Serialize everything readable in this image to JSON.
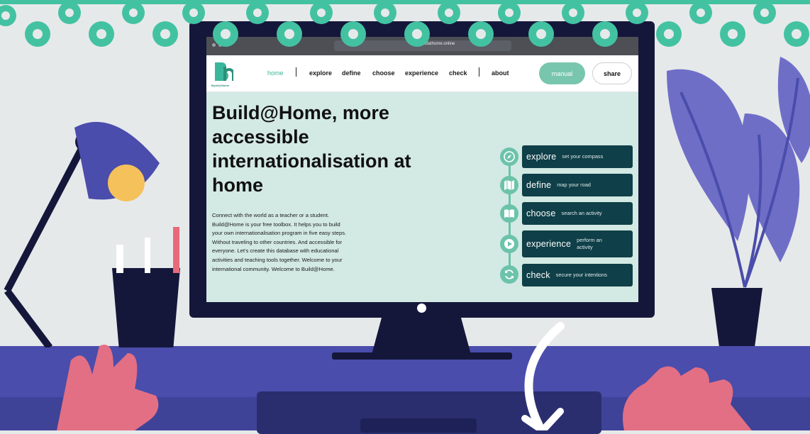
{
  "browser": {
    "url": "buildathome.online"
  },
  "site": {
    "logo_text": "Build@Home",
    "nav": [
      {
        "label": "home"
      },
      {
        "label": "explore"
      },
      {
        "label": "define"
      },
      {
        "label": "choose"
      },
      {
        "label": "experience"
      },
      {
        "label": "check"
      },
      {
        "label": "about"
      }
    ],
    "manual_label": "manual",
    "share_label": "share"
  },
  "hero": {
    "title": "Build@Home, more accessible internationalisation at home",
    "text": "Connect with the world as a teacher or a student. Build@Home is your free toolbox. It helps you to build your own internationalisation program in five easy steps. Without traveling to other countries. And accessible for everyone. Let's create this database with educational activities and teaching tools together. Welcome to your international community. Welcome to Build@Home."
  },
  "steps": [
    {
      "name": "explore",
      "sub": "set your compass",
      "icon": "compass-icon"
    },
    {
      "name": "define",
      "sub": "map your road",
      "icon": "map-icon"
    },
    {
      "name": "choose",
      "sub": "search an activity",
      "icon": "book-icon"
    },
    {
      "name": "experience",
      "sub": "perform an activity",
      "icon": "play-icon"
    },
    {
      "name": "check",
      "sub": "secure your intentions",
      "icon": "refresh-icon"
    }
  ],
  "colors": {
    "accent": "#6cc3a9",
    "card": "#0f3f48",
    "screen_bg": "#d3e9e3",
    "desk": "#4a4dab",
    "monitor": "#15173a"
  }
}
